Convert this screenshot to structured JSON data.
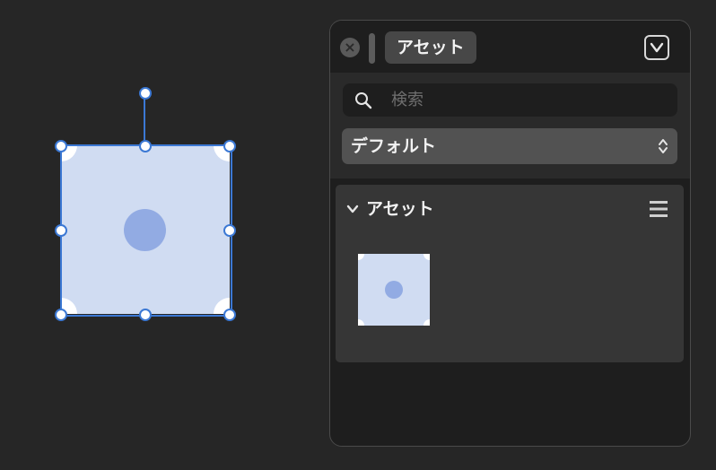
{
  "panel": {
    "title": "アセット",
    "search": {
      "placeholder": "検索",
      "value": ""
    },
    "library_select": {
      "selected": "デフォルト"
    },
    "section": {
      "title": "アセット",
      "collapsed": false
    },
    "asset_count_visible": 1
  },
  "colors": {
    "canvas_bg": "#262626",
    "selection": "#3b78d4",
    "shape_fill": "#d0dcf2",
    "shape_dot": "#92abe3",
    "panel_bg": "#1e1e1e"
  },
  "icons": {
    "close": "close-icon",
    "grip": "drag-grip-icon",
    "collapse": "chevron-down-icon",
    "search": "search-icon",
    "select_arrows": "up-down-chevron-icon",
    "section_toggle": "chevron-down-icon",
    "section_menu": "list-menu-icon"
  }
}
